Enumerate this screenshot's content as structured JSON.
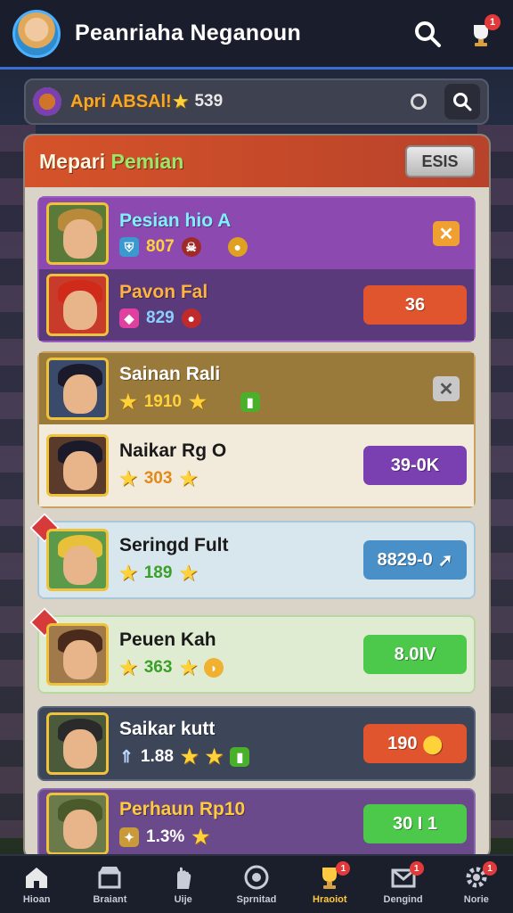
{
  "header": {
    "title": "Peanriaha Neganoun",
    "notification_badge": "1"
  },
  "search": {
    "label": "Apri ABSAl!",
    "count": "539"
  },
  "panel": {
    "title_part1": "Mepari",
    "title_part2": "Pemian",
    "button_label": "ESIS"
  },
  "players": [
    {
      "name": "Pesian hio A",
      "stat": "807",
      "color": "#7ff0ff"
    },
    {
      "name": "Pavon Fal",
      "stat": "829",
      "value": "36",
      "color": "#ffb340"
    },
    {
      "name": "Sainan Rali",
      "stat": "1910",
      "color": "#ffffff"
    },
    {
      "name": "Naikar Rg O",
      "stat": "303",
      "value": "39-0K",
      "color": "#1a1a1a"
    },
    {
      "name": "Seringd Fult",
      "stat": "189",
      "value": "8829-0",
      "color": "#1a1a1a"
    },
    {
      "name": "Peuen Kah",
      "stat": "363",
      "value": "8.0IV",
      "color": "#1a1a1a"
    },
    {
      "name": "Saikar kutt",
      "stat": "1.88",
      "value": "190",
      "color": "#ffffff"
    },
    {
      "name": "Perhaun Rp10",
      "stat": "1.3%",
      "value": "30 I 1",
      "color": "#ffc940"
    }
  ],
  "nav": [
    {
      "label": "Hioan",
      "icon": "home-icon"
    },
    {
      "label": "Braiant",
      "icon": "shop-icon"
    },
    {
      "label": "Uije",
      "icon": "hand-icon"
    },
    {
      "label": "Sprnitad",
      "icon": "target-icon"
    },
    {
      "label": "Hraoiot",
      "icon": "trophy-icon",
      "badge": "1"
    },
    {
      "label": "Dengind",
      "icon": "mail-icon",
      "badge": "1"
    },
    {
      "label": "Norie",
      "icon": "settings-icon",
      "badge": "1"
    }
  ],
  "colors": {
    "accent": "#3a6fd0",
    "panel_header": "#d5532a",
    "orange_button": "#e0552e",
    "purple_button": "#7a3fb0",
    "blue_button": "#4a90c8",
    "green_button": "#4cc84a"
  }
}
